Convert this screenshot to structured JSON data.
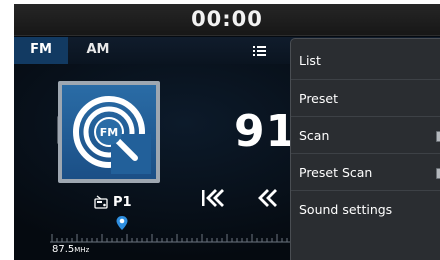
{
  "status": {
    "time": "00:00"
  },
  "tabs": {
    "fm": "FM",
    "am": "AM",
    "menu_icon": "list-menu-icon"
  },
  "radio": {
    "frequency_partial": "91",
    "preset": "P1",
    "preset_icon": "radio-icon",
    "album_art_icon": "fm-broadcast-icon",
    "seek_prev_icon": "double-chevron-left-icon",
    "step_prev_icon": "chevron-left-icon",
    "scale_min": "87.5",
    "scale_unit": "MHz",
    "album_art_label": "FM"
  },
  "menu": {
    "items": [
      {
        "label": "List"
      },
      {
        "label": "Preset"
      },
      {
        "label": "Scan",
        "toggle": false
      },
      {
        "label": "Preset Scan",
        "toggle": false
      },
      {
        "label": "Sound settings"
      }
    ]
  },
  "colors": {
    "active_tab": "#123a62",
    "accent": "#2f8fe0",
    "art_bg": "#2a6ca6",
    "menu_bg": "#2a2d31"
  }
}
